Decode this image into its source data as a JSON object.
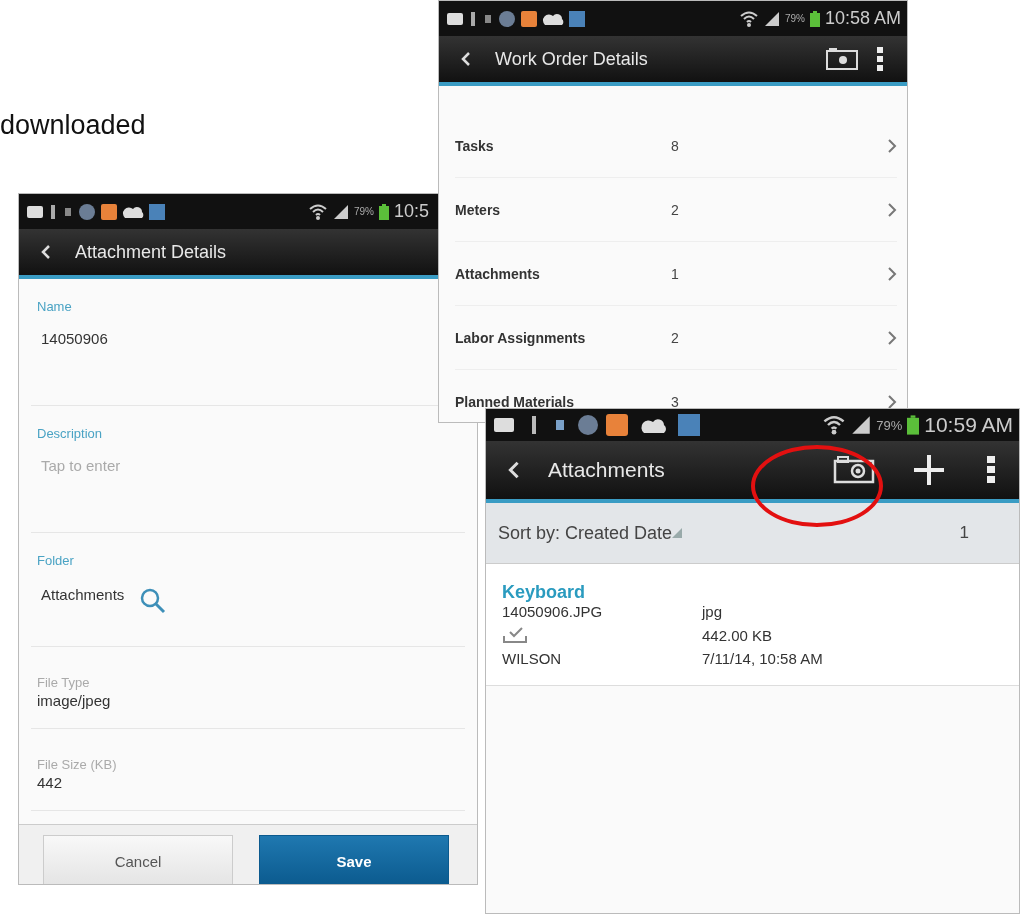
{
  "caption": "downloaded",
  "attachment_details": {
    "status_bar": {
      "battery": "79%",
      "time": "10:5"
    },
    "title": "Attachment Details",
    "fields": [
      {
        "kind": "text",
        "label": "Name",
        "value": "14050906"
      },
      {
        "kind": "input",
        "label": "Description",
        "placeholder": "Tap to enter"
      },
      {
        "kind": "lookup",
        "label": "Folder",
        "value": "Attachments"
      },
      {
        "kind": "readonly",
        "label": "File Type",
        "value": "image/jpeg"
      },
      {
        "kind": "readonly",
        "label": "File Size (KB)",
        "value": "442"
      }
    ],
    "buttons": [
      {
        "kind": "secondary",
        "label": "Cancel"
      },
      {
        "kind": "primary",
        "label": "Save"
      }
    ]
  },
  "work_order_details": {
    "status_bar": {
      "battery": "79%",
      "time": "10:58 AM"
    },
    "title": "Work Order Details",
    "rows": [
      {
        "label": "Tasks",
        "count": "8"
      },
      {
        "label": "Meters",
        "count": "2"
      },
      {
        "label": "Attachments",
        "count": "1"
      },
      {
        "label": "Labor Assignments",
        "count": "2"
      },
      {
        "label": "Planned Materials",
        "count": "3"
      }
    ]
  },
  "attachments": {
    "status_bar": {
      "battery": "79%",
      "time": "10:59 AM"
    },
    "title": "Attachments",
    "sort_label": "Sort by: Created Date",
    "count": "1",
    "items": [
      {
        "title": "Keyboard",
        "file_name": "14050906.JPG",
        "type": "jpg",
        "size": "442.00 KB",
        "author": "WILSON",
        "date": "7/11/14, 10:58 AM"
      }
    ]
  }
}
